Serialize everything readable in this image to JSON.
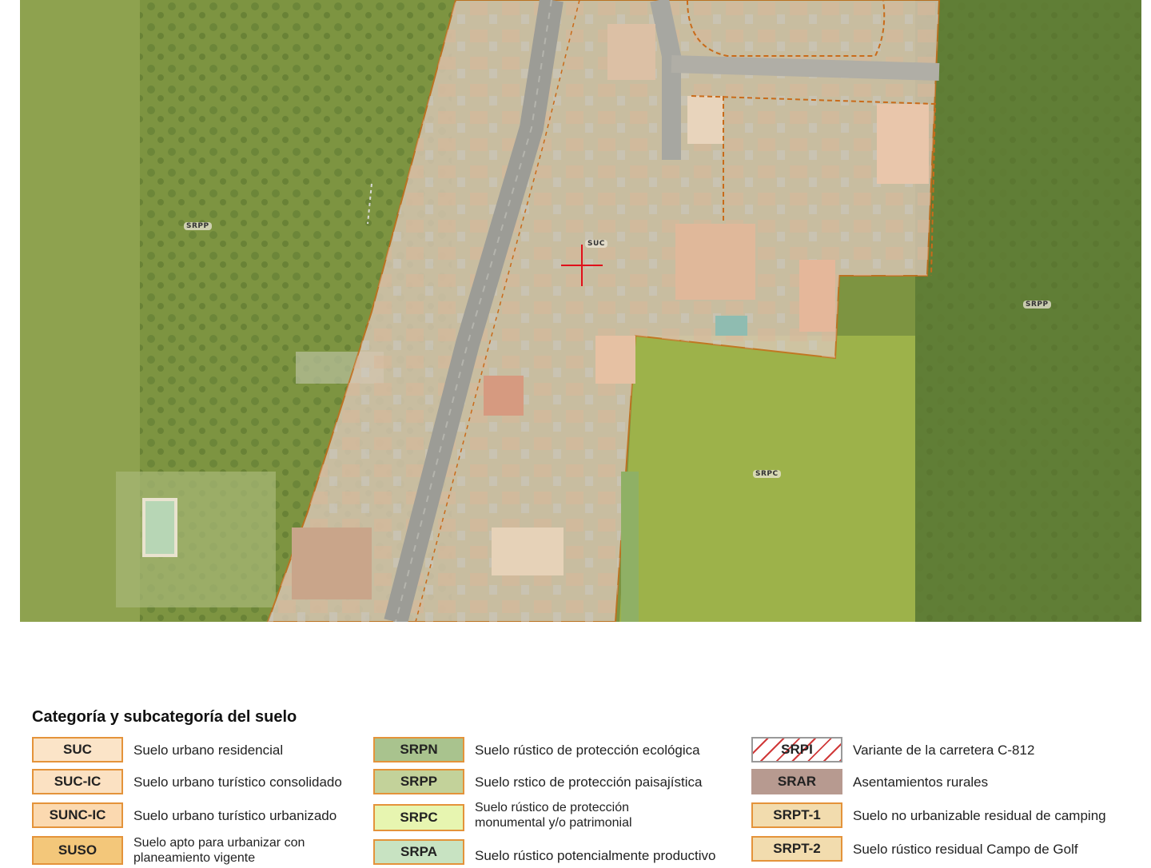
{
  "map": {
    "zone_labels": [
      "SRPP",
      "SUC",
      "SRPP",
      "SRPC"
    ],
    "cursor_icon": "crosshair-icon",
    "colors": {
      "rustic_protection": "#8aa040",
      "urban_overlay": "#e8c8a8",
      "boundary_line": "#c96b1a",
      "crosshair": "#e0101a"
    }
  },
  "legend": {
    "title": "Categoría y subcategoría del suelo",
    "items": [
      {
        "code": "SUC",
        "description": "Suelo urbano residencial",
        "color": "#fbe4c8"
      },
      {
        "code": "SUC-IC",
        "description": "Suelo urbano turístico consolidado",
        "color": "#fbe1c2"
      },
      {
        "code": "SUNC-IC",
        "description": "Suelo urbano turístico urbanizado",
        "color": "#fbd9b0"
      },
      {
        "code": "SUSO",
        "description": "Suelo apto para urbanizar con planeamiento vigente",
        "color": "#f3c77a"
      },
      {
        "code": "SRPN",
        "description": "Suelo rústico de protección ecológica",
        "color": "#a9c38e"
      },
      {
        "code": "SRPP",
        "description": "Suelo rstico de protección paisajística",
        "color": "#c3d29a"
      },
      {
        "code": "SRPC",
        "description": "Suelo rústico de protección monumental y/o patrimonial",
        "color": "#e7f5b0"
      },
      {
        "code": "SRPA",
        "description": "Suelo rústico potencialmente productivo",
        "color": "#c8e3c2"
      },
      {
        "code": "SRPI",
        "description": "Variante de la carretera C-812",
        "color": "#ffffff"
      },
      {
        "code": "SRAR",
        "description": "Asentamientos rurales",
        "color": "#b79a90"
      },
      {
        "code": "SRPT-1",
        "description": "Suelo no urbanizable residual de camping",
        "color": "#f2dcae"
      },
      {
        "code": "SRPT-2",
        "description": "Suelo rústico residual Campo de Golf",
        "color": "#f2dcae"
      }
    ]
  }
}
